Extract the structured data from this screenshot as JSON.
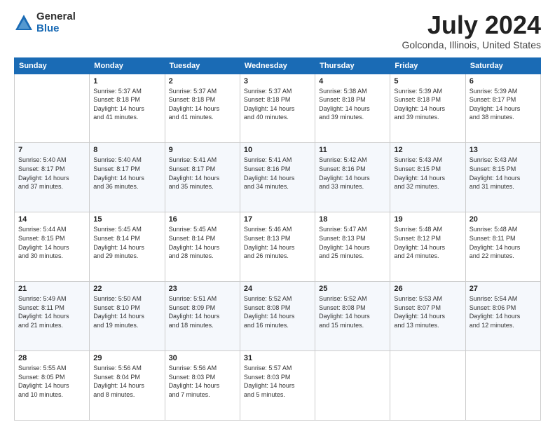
{
  "logo": {
    "general": "General",
    "blue": "Blue"
  },
  "title": "July 2024",
  "location": "Golconda, Illinois, United States",
  "days_of_week": [
    "Sunday",
    "Monday",
    "Tuesday",
    "Wednesday",
    "Thursday",
    "Friday",
    "Saturday"
  ],
  "weeks": [
    [
      {
        "day": "",
        "info": ""
      },
      {
        "day": "1",
        "info": "Sunrise: 5:37 AM\nSunset: 8:18 PM\nDaylight: 14 hours\nand 41 minutes."
      },
      {
        "day": "2",
        "info": "Sunrise: 5:37 AM\nSunset: 8:18 PM\nDaylight: 14 hours\nand 41 minutes."
      },
      {
        "day": "3",
        "info": "Sunrise: 5:37 AM\nSunset: 8:18 PM\nDaylight: 14 hours\nand 40 minutes."
      },
      {
        "day": "4",
        "info": "Sunrise: 5:38 AM\nSunset: 8:18 PM\nDaylight: 14 hours\nand 39 minutes."
      },
      {
        "day": "5",
        "info": "Sunrise: 5:39 AM\nSunset: 8:18 PM\nDaylight: 14 hours\nand 39 minutes."
      },
      {
        "day": "6",
        "info": "Sunrise: 5:39 AM\nSunset: 8:17 PM\nDaylight: 14 hours\nand 38 minutes."
      }
    ],
    [
      {
        "day": "7",
        "info": "Sunrise: 5:40 AM\nSunset: 8:17 PM\nDaylight: 14 hours\nand 37 minutes."
      },
      {
        "day": "8",
        "info": "Sunrise: 5:40 AM\nSunset: 8:17 PM\nDaylight: 14 hours\nand 36 minutes."
      },
      {
        "day": "9",
        "info": "Sunrise: 5:41 AM\nSunset: 8:17 PM\nDaylight: 14 hours\nand 35 minutes."
      },
      {
        "day": "10",
        "info": "Sunrise: 5:41 AM\nSunset: 8:16 PM\nDaylight: 14 hours\nand 34 minutes."
      },
      {
        "day": "11",
        "info": "Sunrise: 5:42 AM\nSunset: 8:16 PM\nDaylight: 14 hours\nand 33 minutes."
      },
      {
        "day": "12",
        "info": "Sunrise: 5:43 AM\nSunset: 8:15 PM\nDaylight: 14 hours\nand 32 minutes."
      },
      {
        "day": "13",
        "info": "Sunrise: 5:43 AM\nSunset: 8:15 PM\nDaylight: 14 hours\nand 31 minutes."
      }
    ],
    [
      {
        "day": "14",
        "info": "Sunrise: 5:44 AM\nSunset: 8:15 PM\nDaylight: 14 hours\nand 30 minutes."
      },
      {
        "day": "15",
        "info": "Sunrise: 5:45 AM\nSunset: 8:14 PM\nDaylight: 14 hours\nand 29 minutes."
      },
      {
        "day": "16",
        "info": "Sunrise: 5:45 AM\nSunset: 8:14 PM\nDaylight: 14 hours\nand 28 minutes."
      },
      {
        "day": "17",
        "info": "Sunrise: 5:46 AM\nSunset: 8:13 PM\nDaylight: 14 hours\nand 26 minutes."
      },
      {
        "day": "18",
        "info": "Sunrise: 5:47 AM\nSunset: 8:13 PM\nDaylight: 14 hours\nand 25 minutes."
      },
      {
        "day": "19",
        "info": "Sunrise: 5:48 AM\nSunset: 8:12 PM\nDaylight: 14 hours\nand 24 minutes."
      },
      {
        "day": "20",
        "info": "Sunrise: 5:48 AM\nSunset: 8:11 PM\nDaylight: 14 hours\nand 22 minutes."
      }
    ],
    [
      {
        "day": "21",
        "info": "Sunrise: 5:49 AM\nSunset: 8:11 PM\nDaylight: 14 hours\nand 21 minutes."
      },
      {
        "day": "22",
        "info": "Sunrise: 5:50 AM\nSunset: 8:10 PM\nDaylight: 14 hours\nand 19 minutes."
      },
      {
        "day": "23",
        "info": "Sunrise: 5:51 AM\nSunset: 8:09 PM\nDaylight: 14 hours\nand 18 minutes."
      },
      {
        "day": "24",
        "info": "Sunrise: 5:52 AM\nSunset: 8:08 PM\nDaylight: 14 hours\nand 16 minutes."
      },
      {
        "day": "25",
        "info": "Sunrise: 5:52 AM\nSunset: 8:08 PM\nDaylight: 14 hours\nand 15 minutes."
      },
      {
        "day": "26",
        "info": "Sunrise: 5:53 AM\nSunset: 8:07 PM\nDaylight: 14 hours\nand 13 minutes."
      },
      {
        "day": "27",
        "info": "Sunrise: 5:54 AM\nSunset: 8:06 PM\nDaylight: 14 hours\nand 12 minutes."
      }
    ],
    [
      {
        "day": "28",
        "info": "Sunrise: 5:55 AM\nSunset: 8:05 PM\nDaylight: 14 hours\nand 10 minutes."
      },
      {
        "day": "29",
        "info": "Sunrise: 5:56 AM\nSunset: 8:04 PM\nDaylight: 14 hours\nand 8 minutes."
      },
      {
        "day": "30",
        "info": "Sunrise: 5:56 AM\nSunset: 8:03 PM\nDaylight: 14 hours\nand 7 minutes."
      },
      {
        "day": "31",
        "info": "Sunrise: 5:57 AM\nSunset: 8:03 PM\nDaylight: 14 hours\nand 5 minutes."
      },
      {
        "day": "",
        "info": ""
      },
      {
        "day": "",
        "info": ""
      },
      {
        "day": "",
        "info": ""
      }
    ]
  ]
}
